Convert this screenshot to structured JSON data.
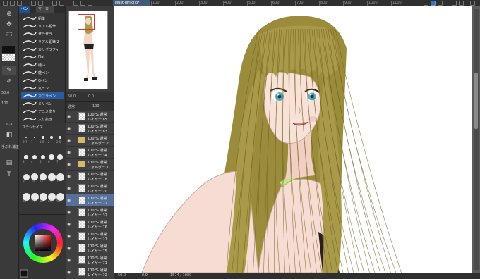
{
  "document_tab": "illust-girl.clip*",
  "ruler_labels": [
    "100",
    "200",
    "300",
    "400",
    "500",
    "600",
    "700",
    "800",
    "900",
    "1000",
    "1100"
  ],
  "subtool_tabs": [
    "ペン",
    "マーカー"
  ],
  "brushes": [
    {
      "label": "鉛筆"
    },
    {
      "label": "リアル鉛筆"
    },
    {
      "label": "ザラザラ"
    },
    {
      "label": "リアル鉛筆 2"
    },
    {
      "label": "カリグラフィ"
    },
    {
      "label": "Flat"
    },
    {
      "label": "硬い"
    },
    {
      "label": "雑ペン"
    },
    {
      "label": "Gペン"
    },
    {
      "label": "丸ペン"
    },
    {
      "label": "カブラペン"
    },
    {
      "label": "ミリペン"
    },
    {
      "label": "アニメ塗り"
    },
    {
      "label": "入り抜き"
    }
  ],
  "size_panel_title": "ブラシサイズ",
  "size_labels": [
    "0.7",
    "1",
    "1.5",
    "2",
    "2.5",
    "3",
    "4",
    "5",
    "6",
    "7",
    "8",
    "10",
    "12",
    "15",
    "17",
    "20",
    "25",
    "30",
    "40",
    "50"
  ],
  "tool_labels": {
    "size_value": "50.0",
    "opacity_value": "100",
    "aa_label": "手ぶれ補正"
  },
  "navigator_zoom": "50.0",
  "navigator_angle": "0.0",
  "layer_blend": "通常",
  "layer_opacity": "100",
  "layers": [
    {
      "type": "layer",
      "pct": "100 % 通常",
      "name": "レイヤー 85"
    },
    {
      "type": "layer",
      "pct": "100 % 通常",
      "name": "レイヤー 83"
    },
    {
      "type": "folder",
      "pct": "100 % 通常",
      "name": "フォルダー 2"
    },
    {
      "type": "layer",
      "pct": "100 % 通常",
      "name": "レイヤー 34"
    },
    {
      "type": "folder",
      "pct": "100 % 通常",
      "name": "フォルダー 1"
    },
    {
      "type": "layer",
      "pct": "100 % 通常",
      "name": "レイヤー 78"
    },
    {
      "type": "layer",
      "pct": "100 % 通常",
      "name": "レイヤー 20"
    },
    {
      "type": "layer",
      "pct": "100 % 通常",
      "name": "レイヤー 22",
      "selected": true
    },
    {
      "type": "layer",
      "pct": "100 % 通常",
      "name": "レイヤー 32"
    },
    {
      "type": "layer",
      "pct": "100 % 通常",
      "name": "レイヤー 76"
    },
    {
      "type": "layer",
      "pct": "100 % 通常",
      "name": "レイヤー 21"
    },
    {
      "type": "layer",
      "pct": "100 % 通常",
      "name": "レイヤー 75"
    },
    {
      "type": "layer",
      "pct": "100 % 通常",
      "name": "レイヤー 71"
    },
    {
      "type": "layer",
      "pct": "100 % 通常",
      "name": "レイヤー 72"
    }
  ],
  "status": {
    "zoom": "50.0",
    "angle": "0.0",
    "coords": "1574 / 1080"
  },
  "colors": {
    "accent": "#2a5aa0",
    "hair": "#a89a48",
    "skin": "#f6dcd2",
    "strap": "#c9e28a"
  }
}
